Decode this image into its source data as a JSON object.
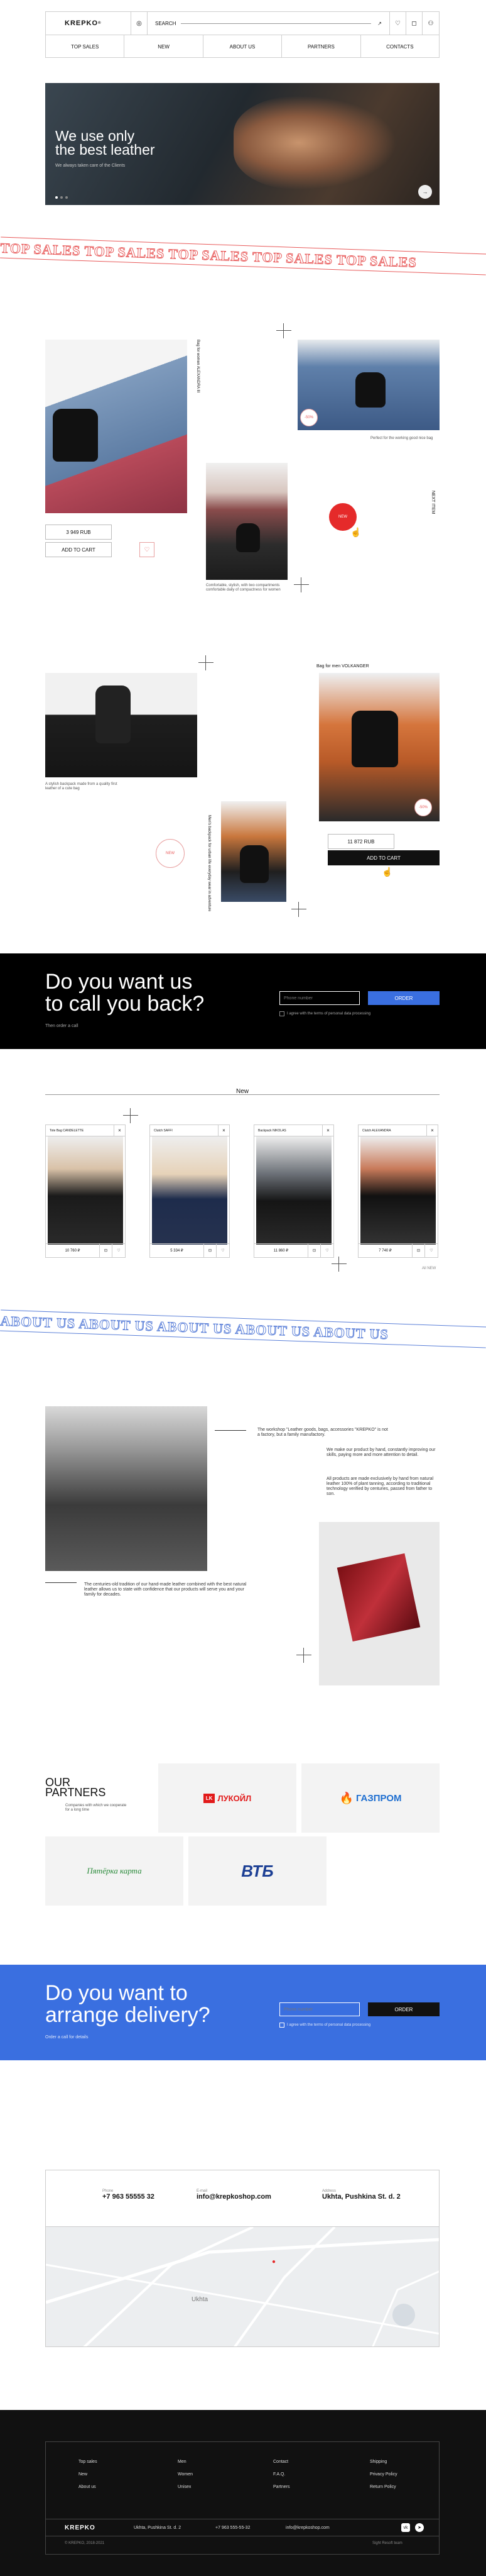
{
  "header": {
    "logo": "KREPKO",
    "logo_mark": "®",
    "search_label": "SEARCH",
    "nav": [
      "TOP SALES",
      "NEW",
      "ABOUT US",
      "PARTNERS",
      "CONTACTS"
    ]
  },
  "hero": {
    "title_line1": "We use only",
    "title_line2": "the best leather",
    "subtitle": "We always taken care of the Clients",
    "arrow": "→"
  },
  "top_sales": {
    "marquee": "TOP SALES TOP SALES TOP SALES TOP SALES TOP SALES",
    "product1": {
      "vert_label": "Bag for women ALEXANDRA III",
      "price": "3 949 RUB",
      "add": "ADD TO CART",
      "heart": "♡"
    },
    "product2": {
      "caption": "Perfect for the working good nice bag",
      "badge": "-50%"
    },
    "product3": {
      "caption": "Comfortable, stylish, with two compartments comfortable daily of compactness for women",
      "badge": "NEW",
      "side": "NEXT ITEM"
    },
    "product4": {
      "caption": "A stylish backpack made from a quality first leather of a cute bag",
      "badge": "NEW"
    },
    "product5": {
      "title": "Bag for men VOLKANGER",
      "price": "11 872 RUB",
      "add": "ADD TO CART",
      "badge": "-50%"
    },
    "product6": {
      "vert_label": "Men's backpack for urban life everyday wear in adventure"
    }
  },
  "call": {
    "title_line1": "Do you want us",
    "title_line2": "to call you back?",
    "subtitle": "Then order a call",
    "placeholder": "Phone number",
    "button": "ORDER",
    "agree": "I agree with the terms of personal data processing"
  },
  "new_section": {
    "title": "New",
    "cards": [
      {
        "title": "Tote Bag CANDELETTE",
        "price": "10 760 ₽"
      },
      {
        "title": "Clutch SAFFI",
        "price": "5 334 ₽"
      },
      {
        "title": "Backpack NIKOLAS",
        "price": "11 860 ₽"
      },
      {
        "title": "Clutch ALEXANDRA",
        "price": "7 740 ₽"
      }
    ],
    "more": "All NEW"
  },
  "about": {
    "marquee": "ABOUT US ABOUT US ABOUT US ABOUT US ABOUT US",
    "p1": "The workshop \"Leather goods, bags, accessories \"KREPKO\" is not a factory, but a family manufactory.",
    "p2": "We make our product by hand, constantly improving our skills, paying more and more attention to detail.",
    "p3": "All products are made exclusively by hand from natural leather 100% of plant tanning, according to traditional technology verified by centuries, passed from father to son.",
    "p4": "The centuries-old tradition of our hand-made leather combined with the best natural leather allows us to state with confidence that our products will serve you and your family for decades."
  },
  "partners": {
    "title_line1": "OUR",
    "title_line2": "PARTNERS",
    "subtitle": "Companies with which we cooperate for a long time",
    "logos": [
      "ЛУКОЙЛ",
      "ГАЗПРОМ",
      "Пятёрка карта",
      "ВТБ"
    ]
  },
  "delivery": {
    "title_line1": "Do you want to",
    "title_line2": "arrange delivery?",
    "subtitle": "Order a call for details",
    "placeholder": "Phone number",
    "button": "ORDER",
    "agree": "I agree with the terms of personal data processing"
  },
  "contacts": {
    "phone_label": "Phone",
    "phone": "+7 963 55555 32",
    "email_label": "E-mail",
    "email": "info@krepkoshop.com",
    "address_label": "Address",
    "address": "Ukhta, Pushkina St. d. 2",
    "map_city": "Ukhta"
  },
  "footer": {
    "col1": [
      "Top sales",
      "New",
      "About us"
    ],
    "col2": [
      "Men",
      "Women",
      "Unisex"
    ],
    "col3": [
      "Contact",
      "F.A.Q.",
      "Partners"
    ],
    "col4": [
      "Shipping",
      "Privacy Policy",
      "Return Policy"
    ],
    "logo": "KREPKO",
    "address": "Ukhta, Pushkina St. d. 2",
    "phone": "+7 963 555-55-32",
    "email": "info@krepkoshop.com",
    "copyright": "© KREPKO, 2018-2021",
    "dev": "Sight Resoft team"
  },
  "colors": {
    "accent_red": "#e52a2a",
    "accent_blue": "#3a6fe0",
    "dark": "#111111"
  }
}
